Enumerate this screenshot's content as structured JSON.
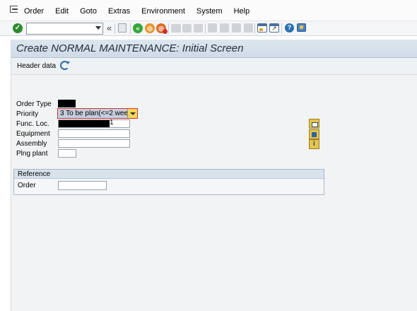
{
  "menu": {
    "items": [
      {
        "label": "Order"
      },
      {
        "label": "Edit"
      },
      {
        "label": "Goto"
      },
      {
        "label": "Extras"
      },
      {
        "label": "Environment"
      },
      {
        "label": "System"
      },
      {
        "label": "Help"
      }
    ]
  },
  "toolbar": {
    "command_field_value": "",
    "icons": [
      "check-icon",
      "command-field",
      "double-arrow-icon",
      "save-icon",
      "back-icon",
      "exit-icon",
      "cancel-icon",
      "print-icon",
      "find-icon",
      "find-next-icon",
      "first-page-icon",
      "previous-page-icon",
      "next-page-icon",
      "last-page-icon",
      "new-session-icon",
      "create-shortcut-icon",
      "help-icon",
      "customize-layout-icon"
    ],
    "double_arrow": "«"
  },
  "screen": {
    "title": "Create NORMAL MAINTENANCE: Initial Screen",
    "header_data_label": "Header data"
  },
  "fields": {
    "order_type_label": "Order Type",
    "priority_label": "Priority",
    "priority_value": "3 To be plan(<=2 wee",
    "func_loc_label": "Func. Loc.",
    "func_loc_tail": "1",
    "equipment_label": "Equipment",
    "assembly_label": "Assembly",
    "plng_plant_label": "Plng plant"
  },
  "reference": {
    "title": "Reference",
    "order_label": "Order"
  },
  "colors": {
    "title_bar": "#cfdbe7",
    "priority_highlight": "#c3cfdf",
    "side_button": "#e8c34a"
  }
}
